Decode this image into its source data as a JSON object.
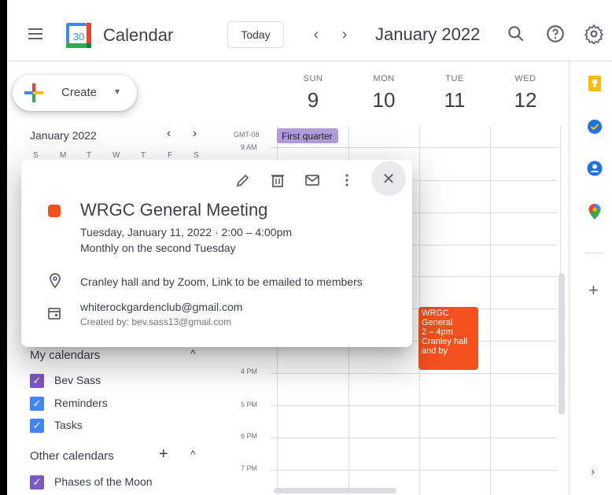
{
  "header": {
    "app_title": "Calendar",
    "logo_day": "30",
    "today_label": "Today",
    "nav_prev": "‹",
    "nav_next": "›",
    "month_label": "January 2022"
  },
  "create": {
    "label": "Create"
  },
  "mini_calendar": {
    "title": "January 2022",
    "dow": [
      "S",
      "M",
      "T",
      "W",
      "T",
      "F",
      "S"
    ]
  },
  "days": [
    {
      "name": "SUN",
      "num": "9"
    },
    {
      "name": "MON",
      "num": "10"
    },
    {
      "name": "TUE",
      "num": "11"
    },
    {
      "name": "WED",
      "num": "12"
    }
  ],
  "timezone": "GMT-08",
  "times": [
    "9 AM",
    "4 PM",
    "5 PM",
    "6 PM",
    "7 PM"
  ],
  "allday_event": "First quarter",
  "event_block": {
    "line1": "WRGC",
    "line2": "General",
    "line3": "2 – 4pm",
    "line4": "Cranley hall",
    "line5": "and by"
  },
  "popup": {
    "title": "WRGC General Meeting",
    "when": "Tuesday, January 11, 2022  ·  2:00 – 4:00pm",
    "recurrence": "Monthly on the second Tuesday",
    "location": "Cranley hall and by Zoom, Link to be emailed to members",
    "calendar": "whiterockgardenclub@gmail.com",
    "created_by": "Created by: bev.sass13@gmail.com",
    "color": "#f4511e"
  },
  "my_calendars": {
    "title": "My calendars",
    "items": [
      {
        "label": "Bev Sass",
        "color": "#7e57c2"
      },
      {
        "label": "Reminders",
        "color": "#4285f4"
      },
      {
        "label": "Tasks",
        "color": "#4285f4"
      }
    ]
  },
  "other_calendars": {
    "title": "Other calendars",
    "items": [
      {
        "label": "Phases of the Moon",
        "color": "#7e57c2"
      }
    ]
  }
}
